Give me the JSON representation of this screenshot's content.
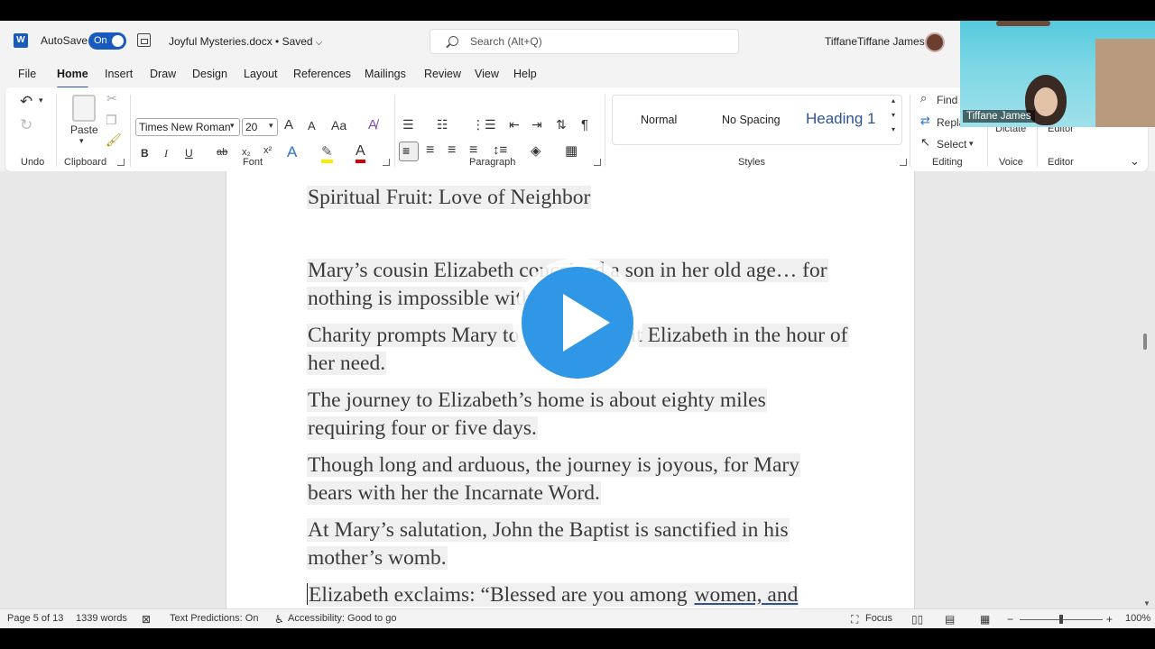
{
  "titlebar": {
    "app_logo": "W",
    "autosave_label": "AutoSave",
    "autosave_state": "On",
    "document_title": "Joyful Mysteries.docx • Saved",
    "search_placeholder": "Search (Alt+Q)",
    "user_name": "TiffaneTiffane James"
  },
  "tabs": [
    {
      "label": "File"
    },
    {
      "label": "Home"
    },
    {
      "label": "Insert"
    },
    {
      "label": "Draw"
    },
    {
      "label": "Design"
    },
    {
      "label": "Layout"
    },
    {
      "label": "References"
    },
    {
      "label": "Mailings"
    },
    {
      "label": "Review"
    },
    {
      "label": "View"
    },
    {
      "label": "Help"
    }
  ],
  "ribbon": {
    "groups": {
      "undo": "Undo",
      "clipboard": "Clipboard",
      "font": "Font",
      "paragraph": "Paragraph",
      "styles": "Styles",
      "editing": "Editing",
      "voice": "Voice",
      "editor": "Editor"
    },
    "paste_label": "Paste",
    "font_name": "Times New Roman",
    "font_size": "20",
    "grow_font": "A",
    "shrink_font": "A",
    "change_case": "Aa",
    "bold": "B",
    "italic": "I",
    "underline": "U",
    "strikethrough": "ab",
    "subscript": "x₂",
    "superscript": "x²",
    "text_effects": "A",
    "font_color": "A",
    "styles": [
      {
        "label": "Normal"
      },
      {
        "label": "No Spacing"
      },
      {
        "label": "Heading 1"
      }
    ],
    "find_label": "Find",
    "replace_label": "Replace",
    "select_label": "Select",
    "dictate_label": "Dictate",
    "editor_label": "Editor"
  },
  "document": {
    "heading": "Spiritual Fruit: Love of Neighbor",
    "paragraphs": [
      {
        "text": "Mary’s cousin Elizabeth conceived a son in her old age… for nothing is impossible with God."
      },
      {
        "text": "Charity prompts Mary to hasten to visit Elizabeth in the hour of her need."
      },
      {
        "text": "The journey to Elizabeth’s home is about eighty miles requiring four or five days."
      },
      {
        "text": "Though long and arduous, the journey is joyous, for Mary bears with her the Incarnate Word."
      },
      {
        "text": "At Mary’s salutation, John the Baptist is sanctified in his mother’s womb."
      }
    ],
    "last_para_start": "Elizabeth exclaims: “Blessed are you among ",
    "last_para_underlined": "women, and"
  },
  "statusbar": {
    "page": "Page 5 of 13",
    "words": "1339 words",
    "text_predictions": "Text Predictions: On",
    "accessibility": "Accessibility: Good to go",
    "focus": "Focus",
    "zoom": "100%"
  },
  "webcam": {
    "name": "Tiffane James"
  },
  "colors": {
    "accent": "#185abd",
    "play_button": "#2f97e6",
    "heading_style": "#2f5496"
  }
}
